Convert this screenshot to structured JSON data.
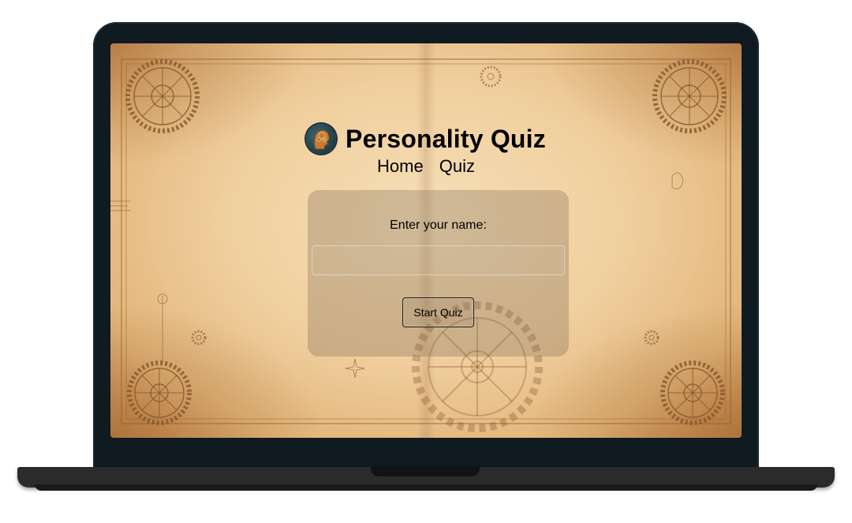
{
  "app": {
    "title": "Personality Quiz",
    "logo_icon": "brain-gears-head-icon"
  },
  "nav": {
    "items": [
      {
        "label": "Home"
      },
      {
        "label": "Quiz"
      }
    ]
  },
  "form": {
    "name_label": "Enter your name:",
    "name_value": "",
    "name_placeholder": "",
    "start_button_label": "Start Quiz"
  },
  "theme": {
    "paper_color": "#f0cf9e",
    "paper_edge_color": "#c68b4d",
    "card_tint": "#786450",
    "laptop_frame_color": "#0f1a21",
    "laptop_base_color": "#2b2b2b"
  }
}
